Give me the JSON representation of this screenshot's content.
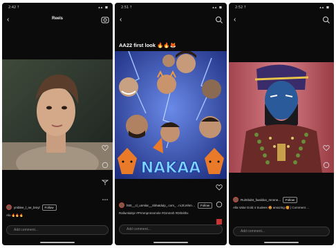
{
  "status": {
    "time1": "2:42 ?",
    "time2": "2:51 ?",
    "time3": "2:52 ?",
    "icons": "▴▴ ◼"
  },
  "panel1": {
    "header": "Reels",
    "username": "ymblee_l_ne_bmyl",
    "follow_label": "Follow",
    "caption": "Alu 🔥🔥🔥",
    "comment_placeholder": "Add comment..."
  },
  "panel2": {
    "title": "AA22 first look 🔥🔥🦊",
    "poster_text": "NAKAA",
    "username": "h00__cl_unmlar__nbhatdulp_.com_ ..ni,0l,mhmmal_imwmjn,mhla",
    "follow_label": "Follow",
    "caption": "Rallumlalrpr #Prmmpnmnmnle #Gmmnh #Dtlmlthx",
    "comment_placeholder": "Add comment..."
  },
  "panel3": {
    "username": "Rulmbdnt_faeddon_mnnne...",
    "follow_label": "Follow",
    "caption": "Alla Valut Gold 4 Sudees 🤩 amazing 🥰 | Comment ...",
    "comment_placeholder": "Add comment..."
  },
  "colors": {
    "background": "#0b0b0b",
    "poster_blue": "#2a4fb8",
    "poster_lightning": "#7fb0ff"
  }
}
